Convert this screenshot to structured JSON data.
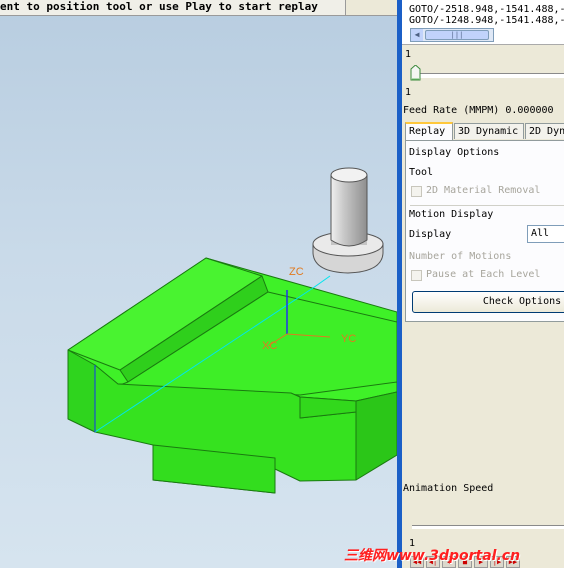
{
  "prompt": {
    "text": "ent to position tool or use Play to start replay"
  },
  "clsf": {
    "lines": [
      "GOTO/-2518.948,-1541.488,-",
      "GOTO/-1248.948,-1541.488,-"
    ]
  },
  "scroll_thumb_glyph": "|||",
  "step_slider": {
    "top_value": "1",
    "bottom_value": "1",
    "position": 0.0
  },
  "feed_rate": {
    "label": "Feed Rate (MMPM)",
    "value": "0.000000"
  },
  "tabs": [
    {
      "label": "Replay",
      "active": true
    },
    {
      "label": "3D Dynamic",
      "active": false
    },
    {
      "label": "2D Dyn",
      "active": false
    }
  ],
  "display_options": {
    "header": "Display Options",
    "tool_label": "Tool",
    "material_removal": {
      "label": "2D Material Removal",
      "checked": false,
      "enabled": false
    }
  },
  "motion_display": {
    "header": "Motion Display",
    "display_label": "Display",
    "display_value": "All",
    "number_of_motions_label": "Number of Motions",
    "pause_each_level": {
      "label": "Pause at Each Level",
      "checked": false,
      "enabled": false
    },
    "check_options_label": "Check Options"
  },
  "animation": {
    "label": "Animation Speed",
    "value": "1"
  },
  "axes": {
    "zc": "ZC",
    "yc": "YC",
    "xc": "XC"
  },
  "watermark": "三维网www.3dportal.cn",
  "colors": {
    "part_green": "#33e01e",
    "path_cyan": "#00e5ee",
    "selection_blue": "#1b5fc7",
    "axis_orange": "#e07a20"
  }
}
